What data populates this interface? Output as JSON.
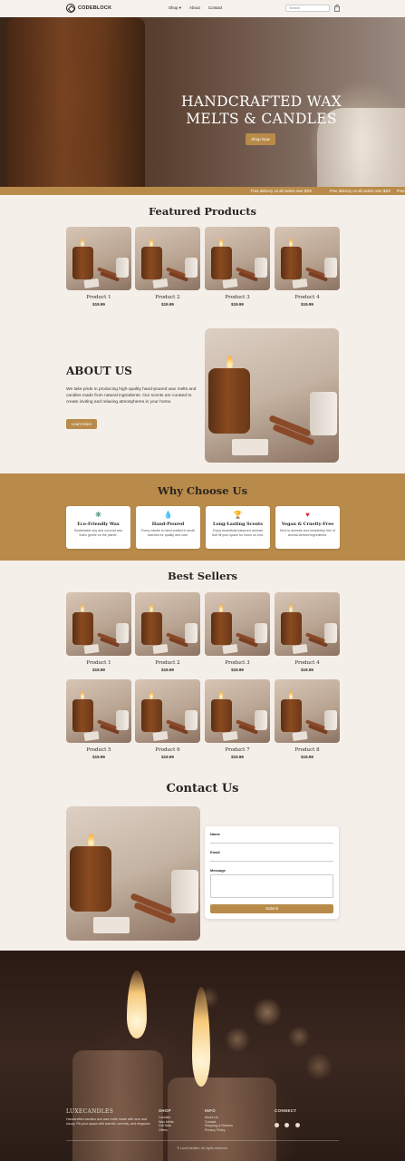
{
  "header": {
    "logo": "CODEBLOCK",
    "nav": [
      "Shop",
      "About",
      "Contact"
    ],
    "search_placeholder": "Search"
  },
  "hero": {
    "title_line1": "HANDCRAFTED WAX",
    "title_line2": "MELTS & CANDLES",
    "button": "Shop Now"
  },
  "ticker": {
    "text": "Free delivery on all orders over $20!"
  },
  "featured": {
    "title": "Featured Products",
    "products": [
      {
        "name": "Product 1",
        "price": "$19.99"
      },
      {
        "name": "Product 2",
        "price": "$19.99"
      },
      {
        "name": "Product 3",
        "price": "$19.99"
      },
      {
        "name": "Product 4",
        "price": "$19.99"
      }
    ]
  },
  "about": {
    "title": "ABOUT US",
    "text": "We take pride in producing high-quality hand-poured wax melts and candles made from natural ingredients. Our scents are curated to create inviting and relaxing atmospheres in your home.",
    "button": "Learn More"
  },
  "why": {
    "title": "Why Choose Us",
    "cards": [
      {
        "icon": "leaf-icon",
        "glyph": "❋",
        "color": "#3d8a6a",
        "name": "Eco-Friendly Wax",
        "desc": "Sustainable soy and coconut wax that's gentle on the planet."
      },
      {
        "icon": "droplet-icon",
        "glyph": "💧",
        "color": "#4a8ac8",
        "name": "Hand-Poured",
        "desc": "Every candle is hand-crafted in small batches for quality and care."
      },
      {
        "icon": "trophy-icon",
        "glyph": "🏆",
        "color": "#d8a020",
        "name": "Long-Lasting Scents",
        "desc": "Enjoy beautifully balanced aromas that fill your space for hours on end."
      },
      {
        "icon": "heart-icon",
        "glyph": "♥",
        "color": "#d82a3a",
        "name": "Vegan & Cruelty-Free",
        "desc": "Kind to animals and completely free of animal-derived ingredients."
      }
    ]
  },
  "bestsellers": {
    "title": "Best Sellers",
    "products": [
      {
        "name": "Product 1",
        "price": "$19.99"
      },
      {
        "name": "Product 2",
        "price": "$19.99"
      },
      {
        "name": "Product 3",
        "price": "$19.99"
      },
      {
        "name": "Product 4",
        "price": "$19.99"
      },
      {
        "name": "Product 5",
        "price": "$19.99"
      },
      {
        "name": "Product 6",
        "price": "$19.99"
      },
      {
        "name": "Product 7",
        "price": "$19.99"
      },
      {
        "name": "Product 8",
        "price": "$19.99"
      }
    ]
  },
  "contact": {
    "title": "Contact Us",
    "name_label": "Name",
    "email_label": "Email",
    "message_label": "Message",
    "submit": "Submit"
  },
  "footer": {
    "brand": "LUXECANDLES",
    "tagline": "Handcrafted candles and wax melts made with love and luxury. Fill your space with warmth, serenity, and elegance.",
    "shop_title": "SHOP",
    "shop_links": [
      "Candles",
      "Wax Melts",
      "Gift Sets",
      "Offers"
    ],
    "info_title": "INFO",
    "info_links": [
      "About Us",
      "Contact",
      "Shipping & Returns",
      "Privacy Policy"
    ],
    "connect_title": "CONNECT",
    "copyright": "© LuxeCandles. All rights reserved."
  },
  "colors": {
    "accent": "#b98b4a",
    "background": "#f5efea"
  }
}
